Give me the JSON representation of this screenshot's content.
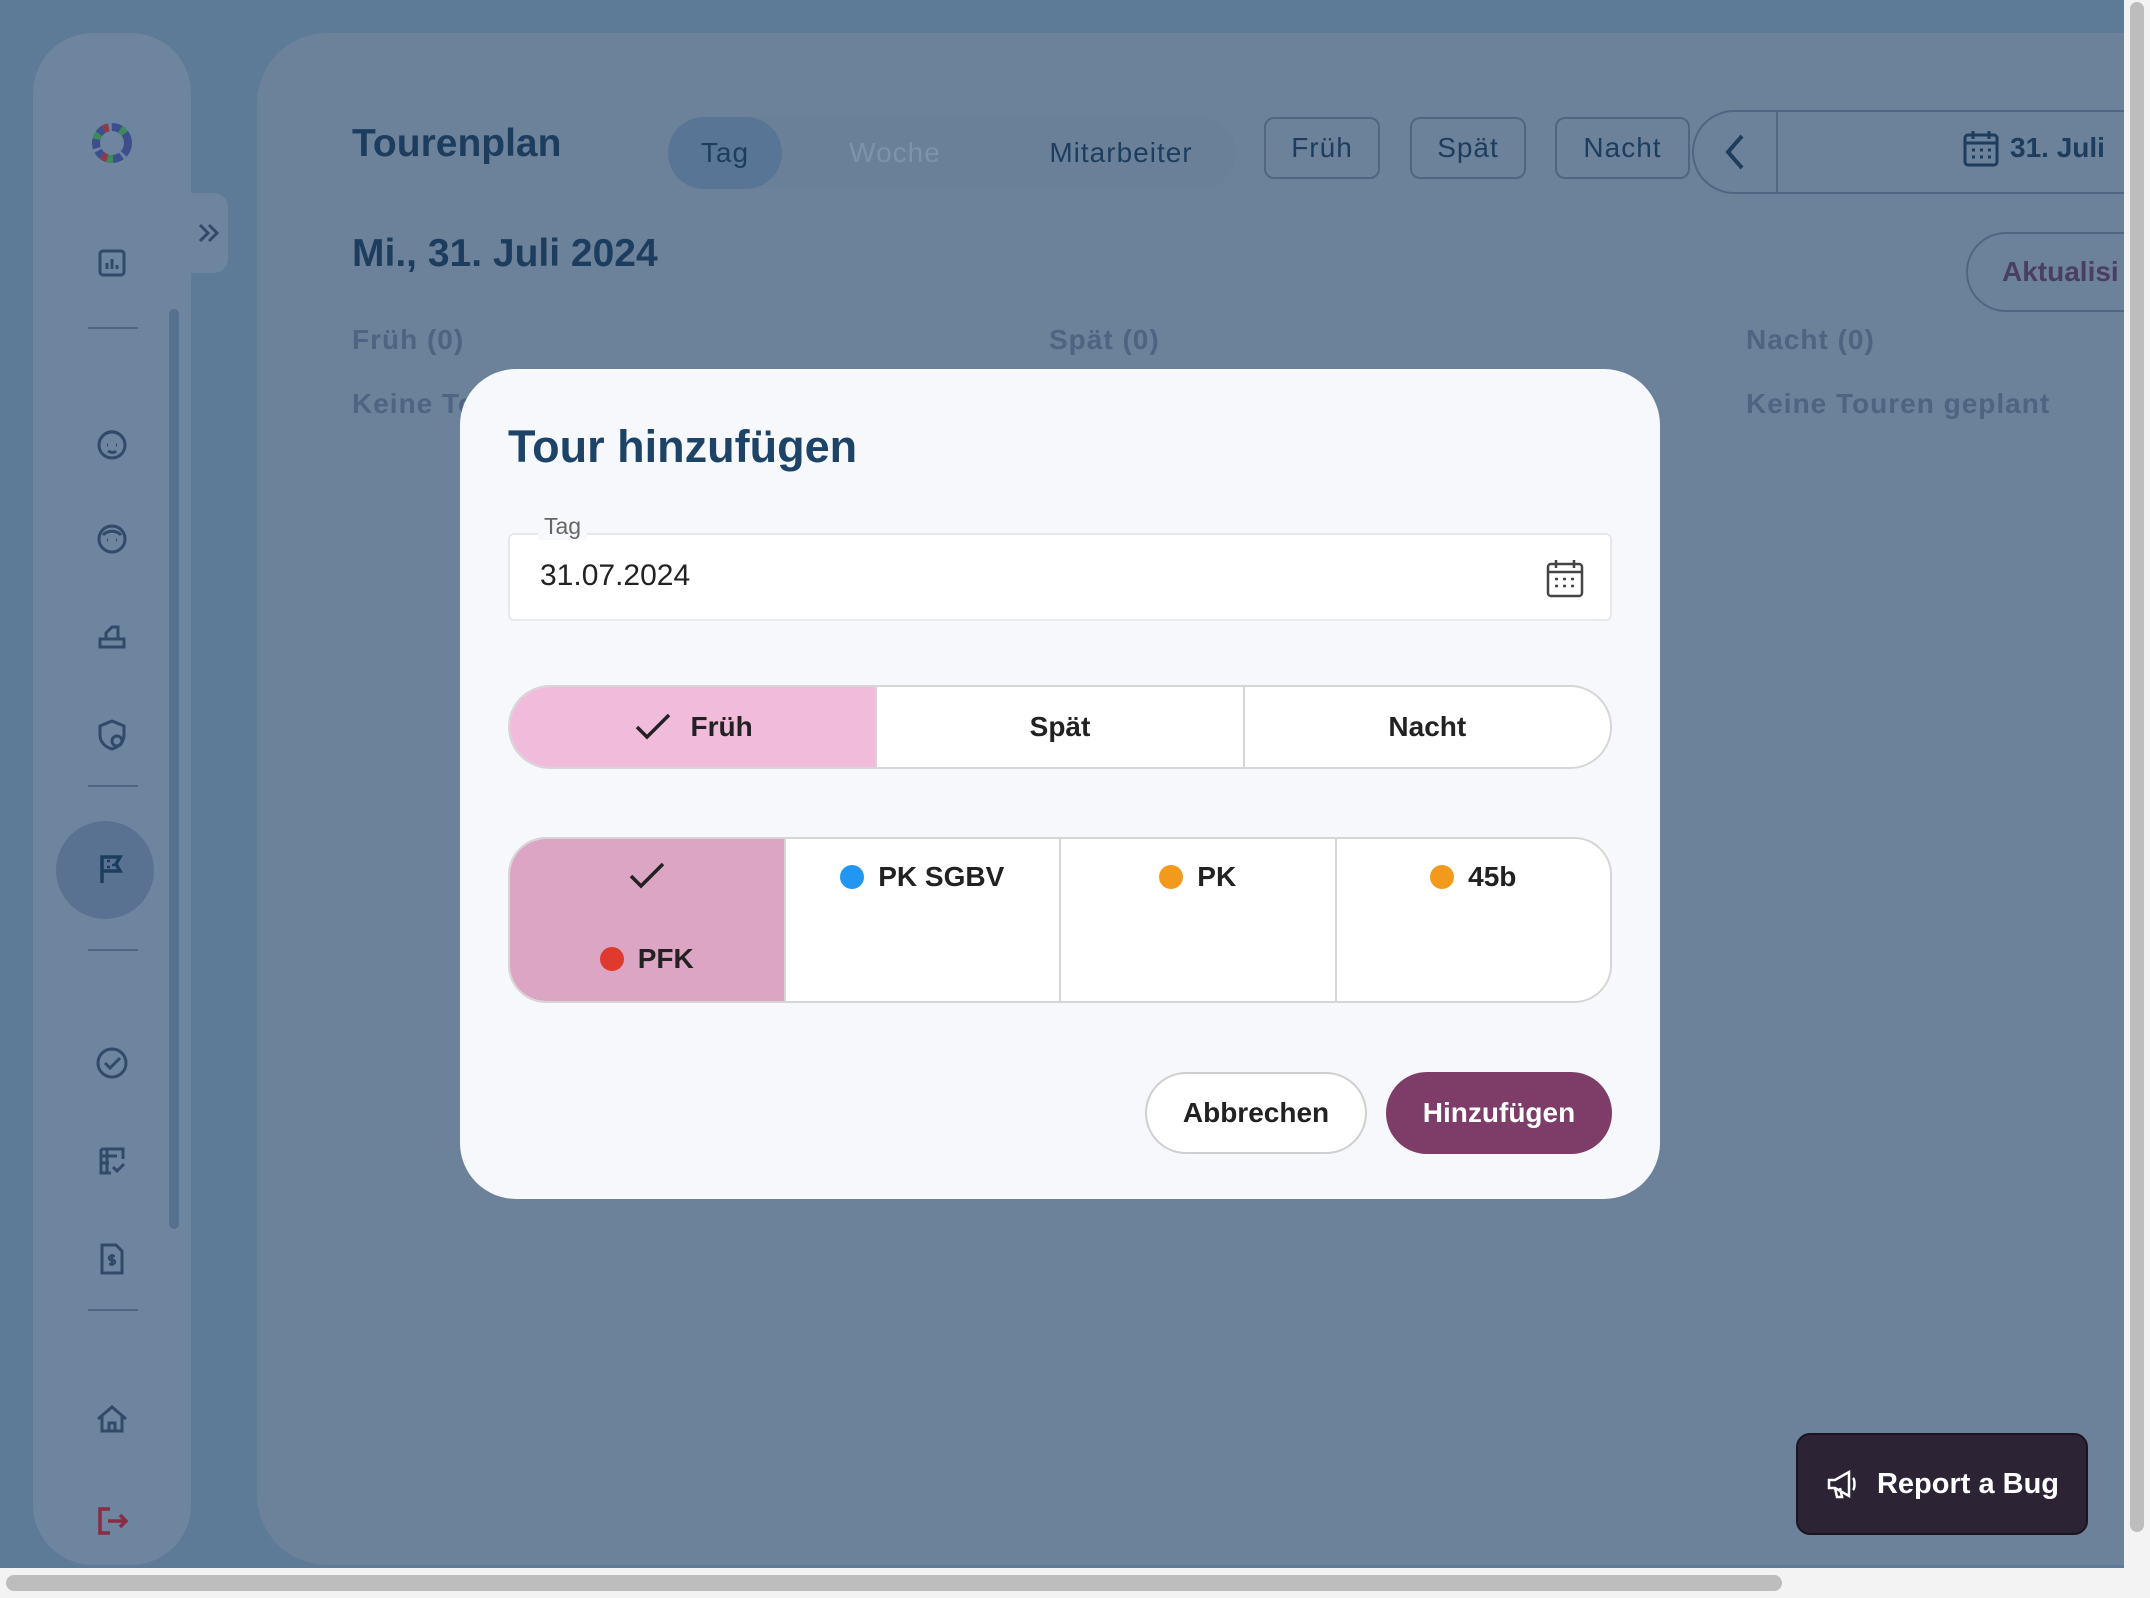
{
  "page": {
    "title": "Tourenplan",
    "view_tabs": [
      {
        "label": "Tag",
        "active": true
      },
      {
        "label": "Woche",
        "active": false
      },
      {
        "label": "Mitarbeiter",
        "active": false
      }
    ],
    "shift_filters": [
      "Früh",
      "Spät",
      "Nacht"
    ],
    "current_date": "31. Juli",
    "date_heading": "Mi., 31. Juli 2024",
    "refresh_label": "Aktualisi",
    "columns": [
      {
        "heading": "Früh (0)",
        "empty_text": "Keine To"
      },
      {
        "heading": "Spät (0)",
        "empty_text": ""
      },
      {
        "heading": "Nacht (0)",
        "empty_text": "Keine Touren geplant"
      }
    ]
  },
  "sidebar": {
    "icons": [
      "logo",
      "dashboard-icon",
      "client-icon",
      "client-alt-icon",
      "staff-icon",
      "insurance-icon",
      "tour-flag-icon",
      "check-icon",
      "checklist-icon",
      "invoice-icon",
      "home-icon",
      "logout-icon"
    ],
    "active": "tour-flag-icon"
  },
  "modal": {
    "title": "Tour hinzufügen",
    "date_field": {
      "label": "Tag",
      "value": "31.07.2024"
    },
    "shift_options": [
      {
        "label": "Früh",
        "selected": true
      },
      {
        "label": "Spät",
        "selected": false
      },
      {
        "label": "Nacht",
        "selected": false
      }
    ],
    "type_options": [
      {
        "label": "PFK",
        "color": "#e03a2f",
        "selected": true
      },
      {
        "label": "PK SGBV",
        "color": "#2196f3",
        "selected": false
      },
      {
        "label": "PK",
        "color": "#f39a1c",
        "selected": false
      },
      {
        "label": "45b",
        "color": "#f39a1c",
        "selected": false
      }
    ],
    "cancel_label": "Abbrechen",
    "submit_label": "Hinzufügen"
  },
  "bug_button": {
    "label": "Report a Bug"
  },
  "colors": {
    "accent": "#7e3c68",
    "title": "#1d4466",
    "selected_shift": "#f1bcdb",
    "selected_type": "#dba5c3",
    "overlay": "#6c819a"
  }
}
